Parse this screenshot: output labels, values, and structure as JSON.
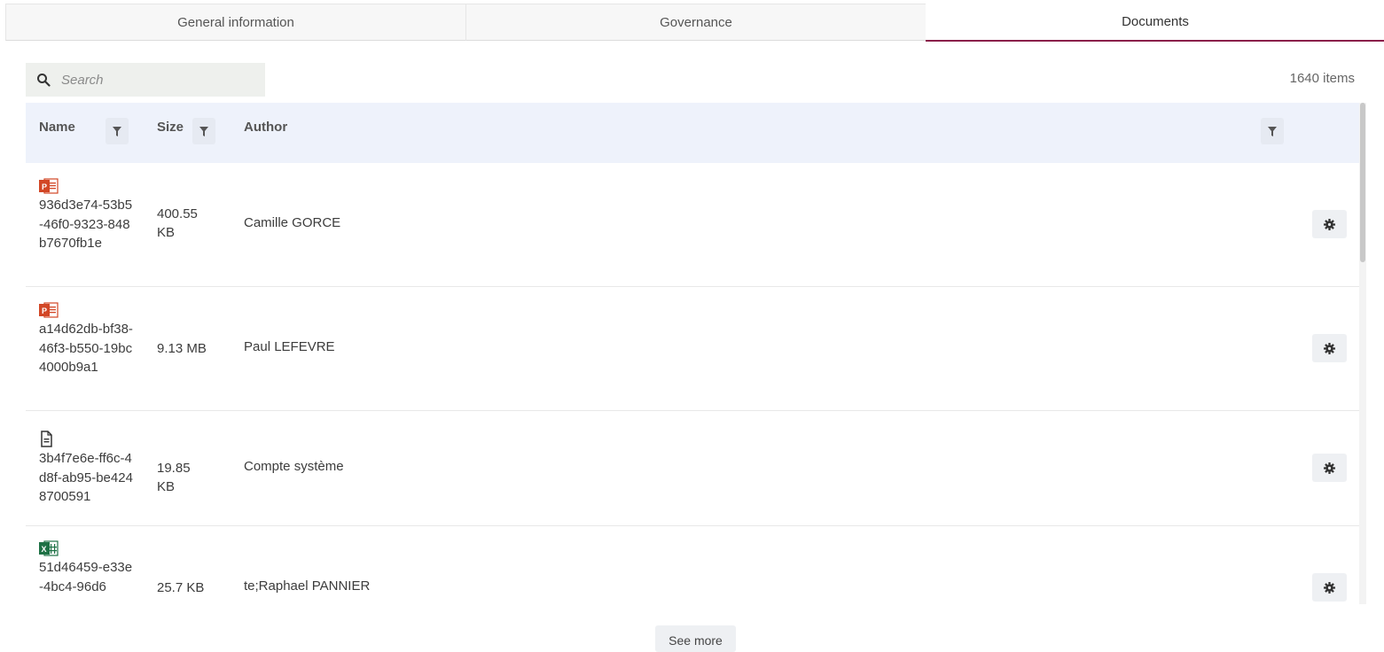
{
  "tabs": [
    {
      "label": "General information",
      "active": false
    },
    {
      "label": "Governance",
      "active": false
    },
    {
      "label": "Documents",
      "active": true
    }
  ],
  "search": {
    "placeholder": "Search",
    "value": ""
  },
  "item_count": "1640 items",
  "columns": {
    "name": "Name",
    "size": "Size",
    "author": "Author"
  },
  "rows": [
    {
      "icon": "powerpoint-file-icon",
      "name": "936d3e74-53b5-46f0-9323-848b7670fb1e",
      "size": "400.55 KB",
      "author": "Camille GORCE"
    },
    {
      "icon": "powerpoint-file-icon",
      "name": "a14d62db-bf38-46f3-b550-19bc4000b9a1",
      "size": "9.13 MB",
      "author": "Paul LEFEVRE"
    },
    {
      "icon": "text-document-icon",
      "name": "3b4f7e6e-ff6c-4d8f-ab95-be4248700591",
      "size": "19.85 KB",
      "author": "Compte système"
    },
    {
      "icon": "excel-file-icon",
      "name": "51d46459-e33e-4bc4-96d6",
      "size": "25.7 KB",
      "author": "te;Raphael PANNIER"
    }
  ],
  "see_more_label": "See more",
  "colors": {
    "accent": "#8a1f4a",
    "header_bg": "#eef2fb",
    "search_bg": "#eef0ed"
  }
}
